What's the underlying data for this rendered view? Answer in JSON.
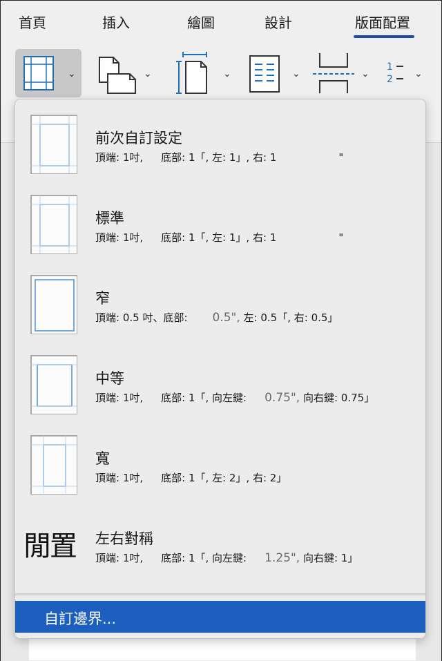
{
  "tabs": [
    {
      "label": "首頁",
      "active": false
    },
    {
      "label": "插入",
      "active": false
    },
    {
      "label": "繪圖",
      "active": false
    },
    {
      "label": "設計",
      "active": false
    },
    {
      "label": "版面配置",
      "active": true
    }
  ],
  "colors": {
    "accent": "#1f4e9c",
    "selection": "#1d5fbf",
    "thumb_line": "#4a8fd0"
  },
  "toolbar": {
    "margins_icon": "margins-icon",
    "orientation_icon": "orientation-icon",
    "size_icon": "size-icon",
    "columns_icon": "columns-icon",
    "breaks_icon": "breaks-icon",
    "line_numbers_icon": "line-numbers-icon"
  },
  "menu": {
    "items": [
      {
        "title": "前次自訂設定",
        "desc": [
          "頂端: 1吋,",
          "底部: 1「, 左: 1」, 右: 1",
          "",
          "\""
        ]
      },
      {
        "title": "標準",
        "desc": [
          "頂端: 1吋,",
          "底部: 1「, 左: 1」, 右: 1",
          "",
          "\""
        ]
      },
      {
        "title": "窄",
        "desc": [
          "頂端: 0.5 吋、底部:",
          "0.5\",",
          "左: 0.5「, 右: 0.5」",
          ""
        ]
      },
      {
        "title": "中等",
        "desc": [
          "頂端: 1吋,",
          "底部: 1「, 向左鍵:",
          "0.75\",",
          "向右鍵: 0.75」"
        ]
      },
      {
        "title": "寬",
        "desc": [
          "頂端: 1吋,",
          "底部: 1「, 左: 2」, 右: 2」",
          "",
          ""
        ]
      },
      {
        "title": "左右對稱",
        "desc": [
          "頂端: 1吋,",
          "底部: 1「, 向左鍵:",
          "1.25\",",
          "向右鍵: 1」"
        ]
      }
    ],
    "mirror_glyph": "閒置",
    "custom_label": "自訂邊界..."
  }
}
